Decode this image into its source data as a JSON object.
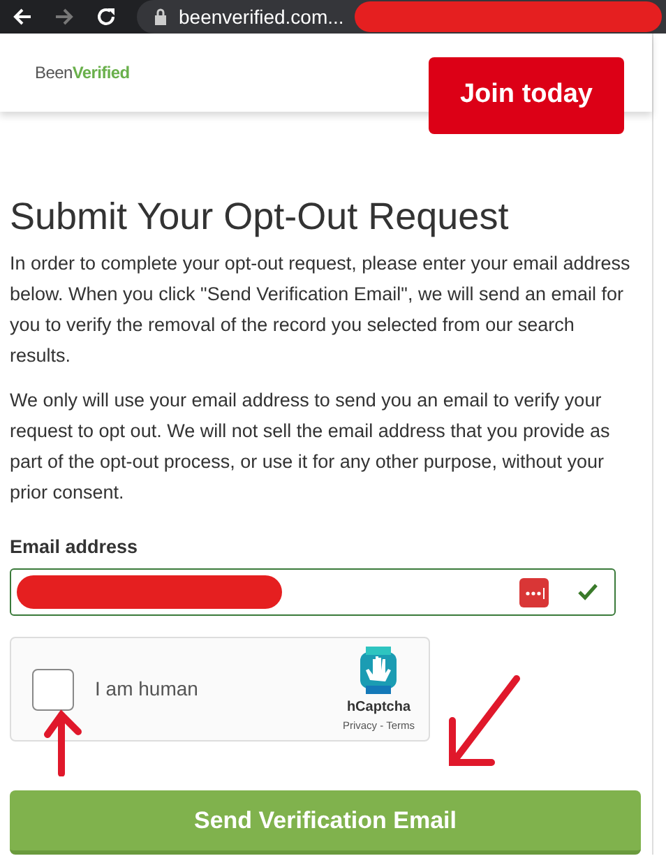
{
  "browser": {
    "url": "beenverified.com..."
  },
  "header": {
    "logo": {
      "prefix": "Been",
      "highlight": "Verified"
    },
    "join_button": "Join today"
  },
  "title": "Submit Your Opt-Out Request",
  "paragraphs": [
    "In order to complete your opt-out request, please enter your email address below. When you click \"Send Verification Email\", we will send an email for you to verify the removal of the record you selected from our search results.",
    "We only will use your email address to send you an email to verify your request to opt out. We will not sell the email address that you provide as part of the opt-out process, or use it for any other purpose, without your prior consent."
  ],
  "email": {
    "label": "Email address",
    "valid": true
  },
  "captcha": {
    "label": "I am human",
    "checked": false,
    "brand": "hCaptcha",
    "links": [
      "Privacy",
      "Terms"
    ],
    "separator": "-"
  },
  "submit_button": "Send Verification Email"
}
